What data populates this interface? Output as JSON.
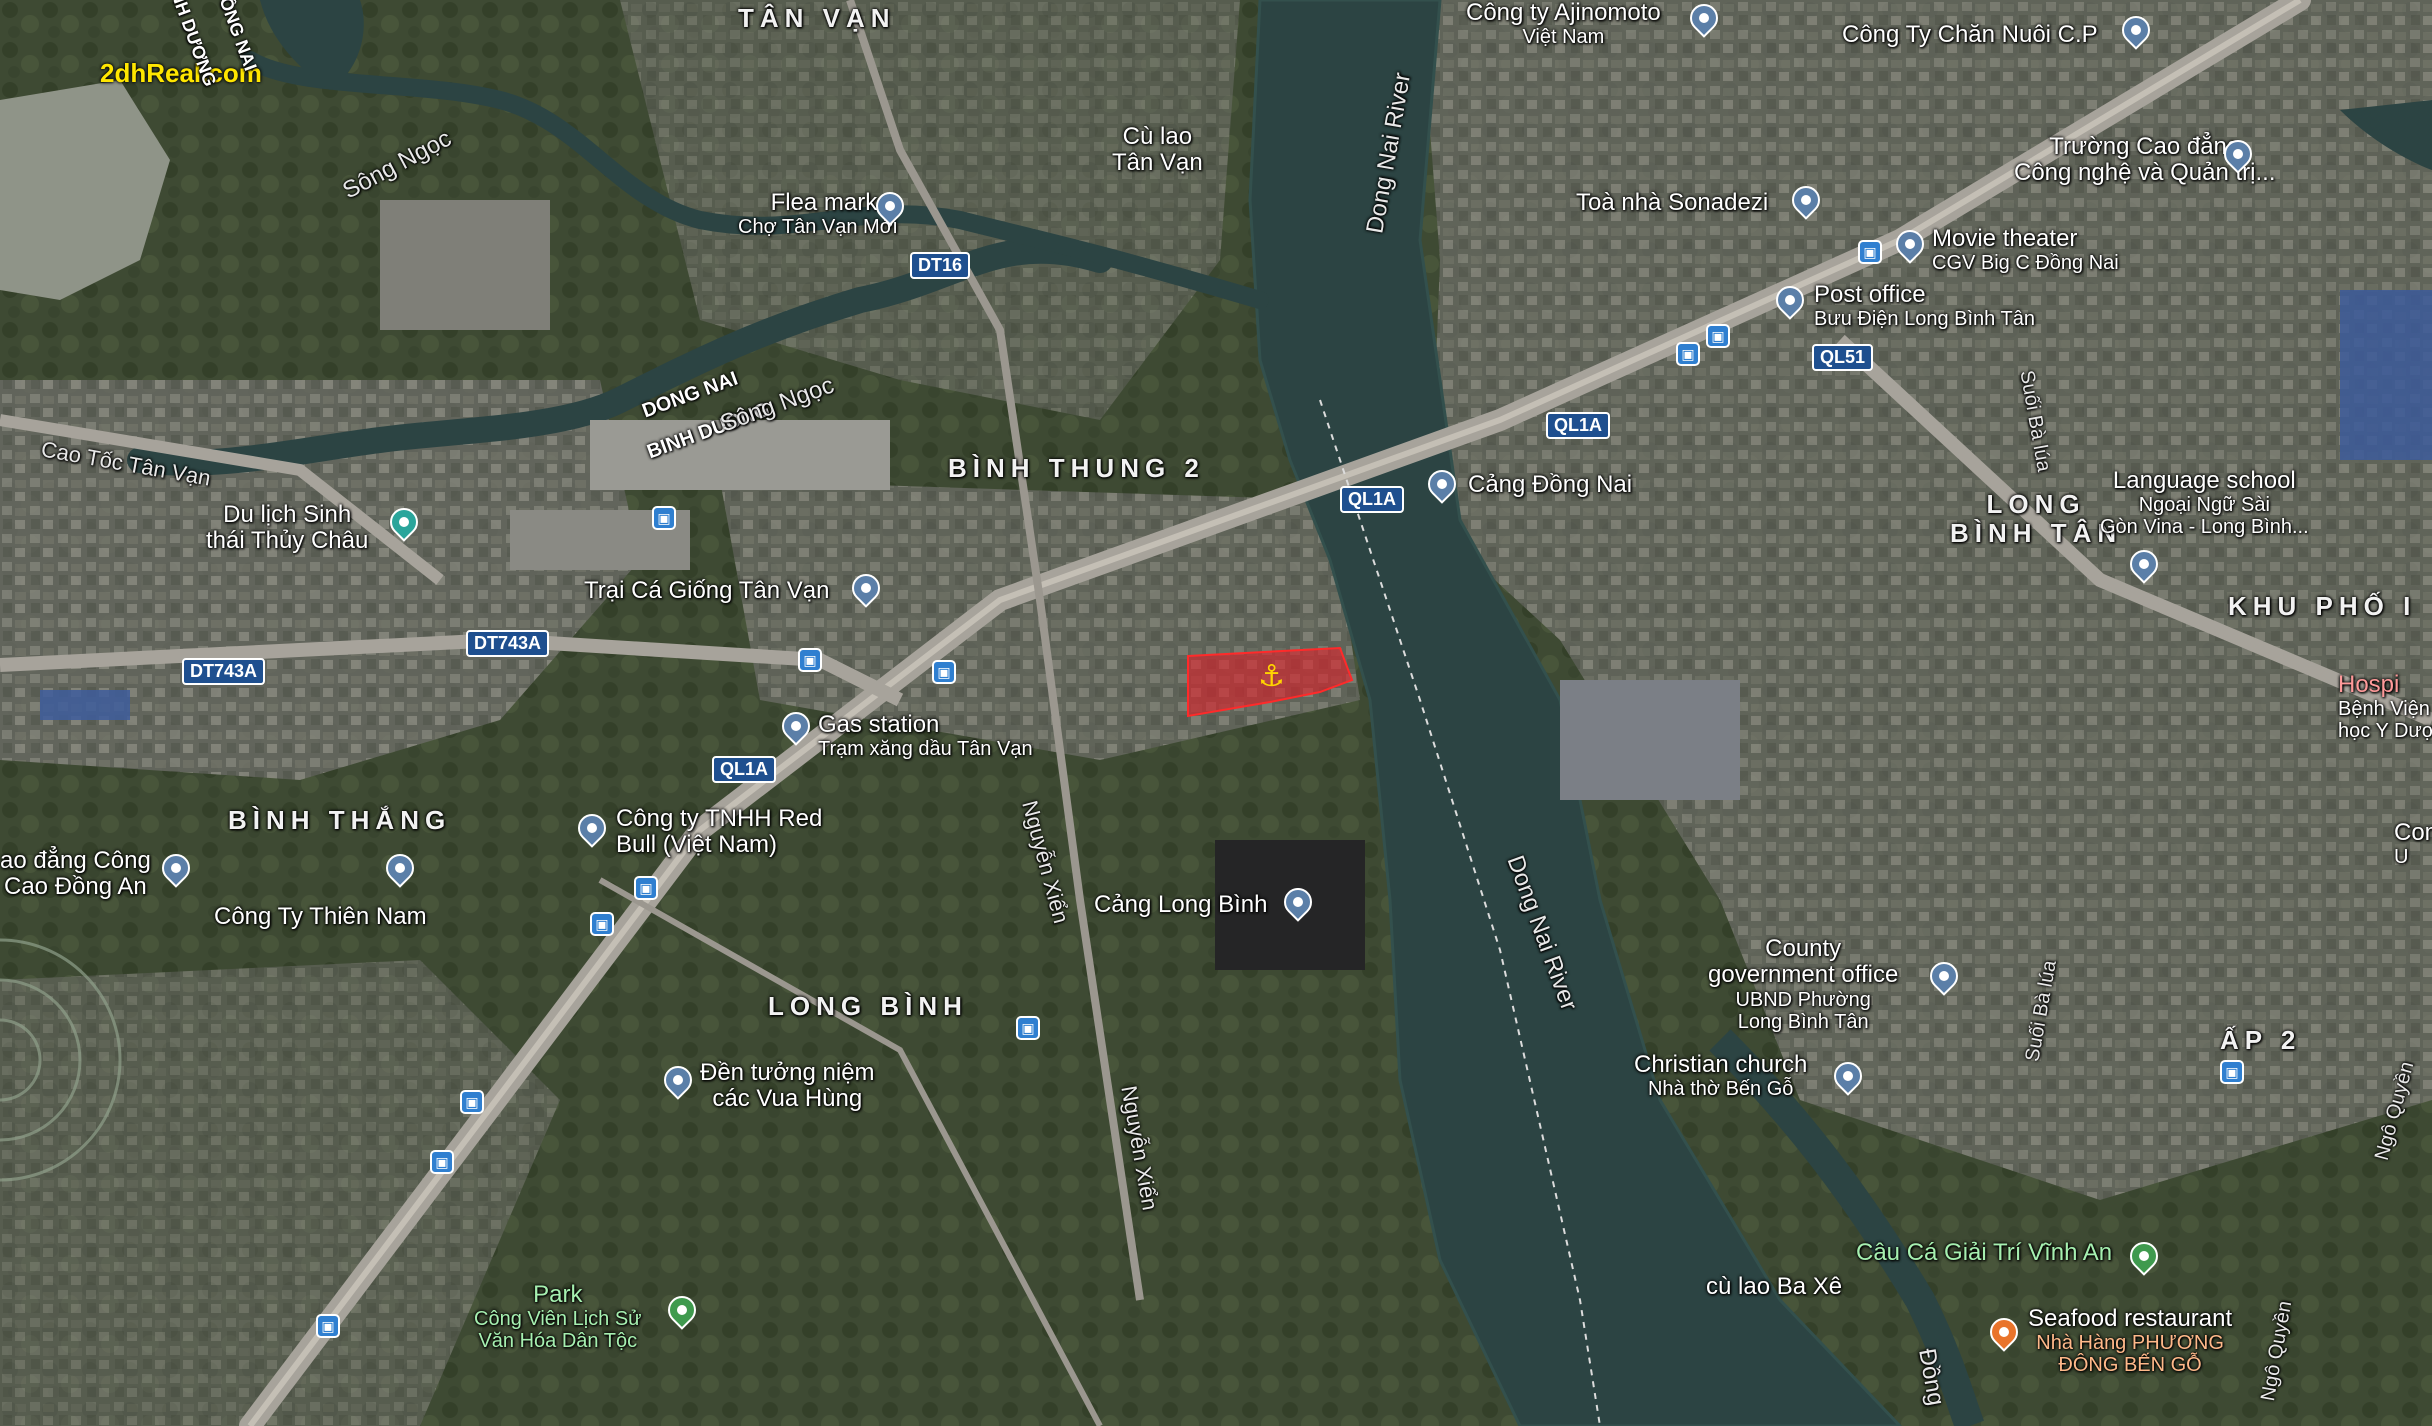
{
  "watermark": "2dhReal.com",
  "areas": {
    "tan_van": "TÂN VẠN",
    "binh_thung_2": "BÌNH THUNG 2",
    "long_binh_tan": [
      "LONG",
      "BÌNH TÂN"
    ],
    "khu_pho": "KHU PHỐ I",
    "binh_thang": "BÌNH THẮNG",
    "long_binh": "LONG BÌNH",
    "ap_2": "ẤP 2"
  },
  "places": {
    "cu_lao_tan_van": [
      "Cù lao",
      "Tân Vạn"
    ],
    "cu_lao_ba_xe": "cù lao Ba Xê",
    "dong_nai_1": "DONG NAI",
    "binh_duong_1": "BINH DUONG",
    "binh_duong_top": "BÌNH DƯƠNG",
    "dong_nai_top": "ĐỒNG NAI"
  },
  "rivers": {
    "song_ngoc_1": "Sông Ngọc",
    "song_ngoc_2": "Sông Ngọc",
    "dong_nai_river_1": "Dong Nai River",
    "dong_nai_river_2": "Dong Nai River",
    "dong_nai_river_3": "Đồng",
    "suoi_ba_lua_1": "Suối Bà lúa",
    "suoi_ba_lua_2": "Suối Bà lúa"
  },
  "roads": {
    "dt16": "DT16",
    "ql1a_1": "QL1A",
    "ql1a_2": "QL1A",
    "ql1a_3": "QL1A",
    "ql51": "QL51",
    "dt743a_1": "DT743A",
    "dt743a_2": "DT743A",
    "cao_toc": "Cao Tốc Tân Vạn",
    "nguyen_xien_1": "Nguyễn Xiển",
    "nguyen_xien_2": "Nguyễn Xiển",
    "ngo_quyen_1": "Ngô Quyền",
    "ngo_quyen_2": "Ngô Quyền"
  },
  "pois": {
    "ajinomoto": [
      "Công ty Ajinomoto",
      "Việt Nam"
    ],
    "chan_nuoi": "Công Ty Chăn Nuôi C.P",
    "cao_dang": [
      "Trường Cao đẳng",
      "Công nghệ và Quản trị..."
    ],
    "flea_market": [
      "Flea market",
      "Chợ Tân Vạn Mới"
    ],
    "sonadezi": "Toà nhà Sonadezi",
    "movie": [
      "Movie theater",
      "CGV Big C Đồng Nai"
    ],
    "post": [
      "Post office",
      "Bưu Điện Long Bình Tân"
    ],
    "cang_dong_nai": "Cảng Đồng Nai",
    "language": [
      "Language school",
      "Ngoại Ngữ Sài",
      "Gòn Vina - Long Bình..."
    ],
    "thuy_chau": [
      "Du lịch Sinh",
      "thái Thủy Châu"
    ],
    "trai_ca": "Trại Cá Giống Tân Vạn",
    "gas": [
      "Gas station",
      "Trạm xăng dầu Tân Vạn"
    ],
    "hospital": [
      "Hospi",
      "Bệnh Viện Đ",
      "học Y Dượ"
    ],
    "red_bull": [
      "Công ty TNHH Red",
      "Bull (Việt Nam)"
    ],
    "cao_dang_cong": [
      "ao đẳng Công",
      "Cao Đồng An"
    ],
    "thien_nam": "Công Ty Thiên Nam",
    "cang_long_binh": "Cảng Long Bình",
    "comm": [
      "Comm",
      "U"
    ],
    "county": [
      "County",
      "government office",
      "UBND Phường",
      "Long Bình Tân"
    ],
    "den_tuong_niem": [
      "Đền tưởng niệm",
      "các Vua Hùng"
    ],
    "christian": [
      "Christian church",
      "Nhà thờ Bến Gỗ"
    ],
    "cau_ca": "Câu Cá Giải Trí Vĩnh An",
    "park": [
      "Park",
      "Công Viên Lịch Sử",
      "Văn Hóa Dân Tộc"
    ],
    "seafood": [
      "Seafood restaurant",
      "Nhà Hàng PHƯƠNG",
      "ĐÔNG BẾN GỖ"
    ]
  },
  "colors": {
    "site_fill": "#e0202a",
    "anchor": "#ffd400",
    "pin": "#5b7fa8",
    "bus": "#2f7fd0",
    "watermark": "#ffe600",
    "water": "#2c4443"
  }
}
